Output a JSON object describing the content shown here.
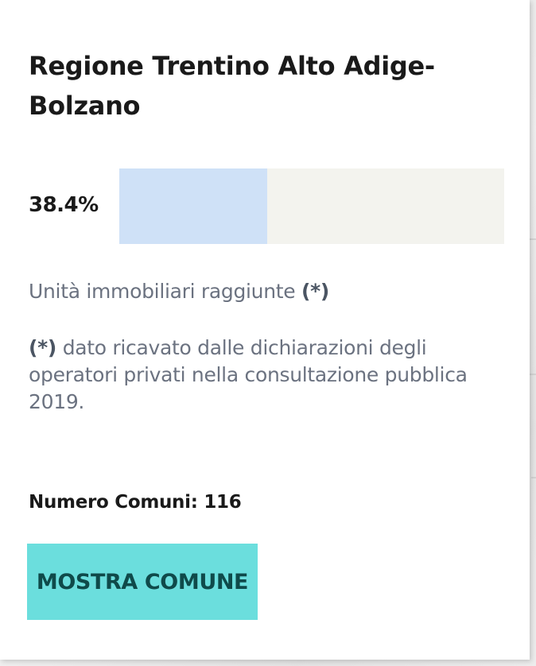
{
  "popup": {
    "title": "Regione Trentino Alto Adige-Bolzano",
    "progress": {
      "label": "38.4%",
      "value_percent": 38.4,
      "fill_color": "#cfe1f7",
      "track_color": "#f3f3ee"
    },
    "caption": {
      "text": "Unità immobiliari raggiunte",
      "marker": "(*)"
    },
    "footnote": {
      "marker": "(*)",
      "text": "dato ricavato dalle dichiarazioni degli operatori privati nella consultazione pubblica 2019."
    },
    "municipalities": {
      "label": "Numero Comuni: 116"
    },
    "show_button": {
      "label": "MOSTRA COMUNE",
      "color": "#6bdedd"
    }
  }
}
